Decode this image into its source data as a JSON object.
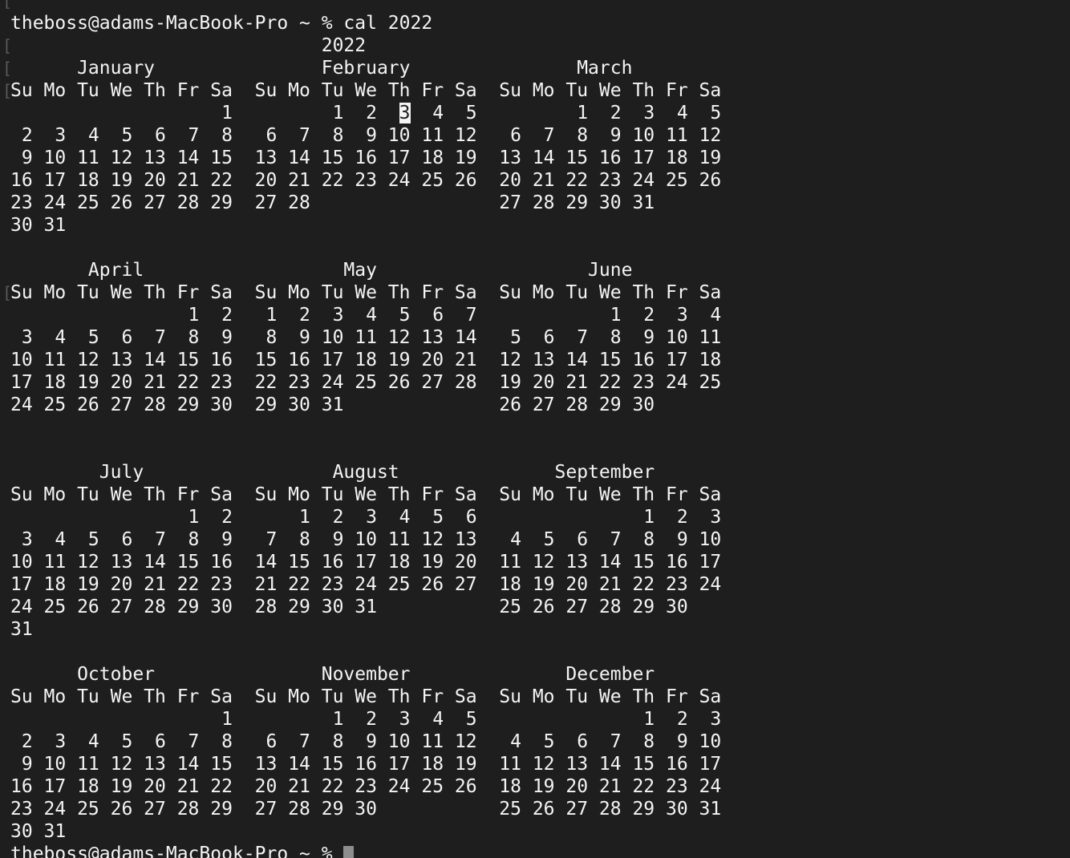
{
  "terminal": {
    "prompt": "theboss@adams-MacBook-Pro ~ % ",
    "command": "cal 2022",
    "output_lines": [
      "                            2022",
      "      January               February               March",
      "Su Mo Tu We Th Fr Sa  Su Mo Tu We Th Fr Sa  Su Mo Tu We Th Fr Sa",
      "                   1         1  2  3  4  5         1  2  3  4  5",
      " 2  3  4  5  6  7  8   6  7  8  9 10 11 12   6  7  8  9 10 11 12",
      " 9 10 11 12 13 14 15  13 14 15 16 17 18 19  13 14 15 16 17 18 19",
      "16 17 18 19 20 21 22  20 21 22 23 24 25 26  20 21 22 23 24 25 26",
      "23 24 25 26 27 28 29  27 28                 27 28 29 30 31",
      "30 31",
      "",
      "       April                  May                   June",
      "Su Mo Tu We Th Fr Sa  Su Mo Tu We Th Fr Sa  Su Mo Tu We Th Fr Sa",
      "                1  2   1  2  3  4  5  6  7            1  2  3  4",
      " 3  4  5  6  7  8  9   8  9 10 11 12 13 14   5  6  7  8  9 10 11",
      "10 11 12 13 14 15 16  15 16 17 18 19 20 21  12 13 14 15 16 17 18",
      "17 18 19 20 21 22 23  22 23 24 25 26 27 28  19 20 21 22 23 24 25",
      "24 25 26 27 28 29 30  29 30 31              26 27 28 29 30",
      "",
      "",
      "        July                 August              September",
      "Su Mo Tu We Th Fr Sa  Su Mo Tu We Th Fr Sa  Su Mo Tu We Th Fr Sa",
      "                1  2      1  2  3  4  5  6               1  2  3",
      " 3  4  5  6  7  8  9   7  8  9 10 11 12 13   4  5  6  7  8  9 10",
      "10 11 12 13 14 15 16  14 15 16 17 18 19 20  11 12 13 14 15 16 17",
      "17 18 19 20 21 22 23  21 22 23 24 25 26 27  18 19 20 21 22 23 24",
      "24 25 26 27 28 29 30  28 29 30 31           25 26 27 28 29 30",
      "31",
      "",
      "      October               November              December",
      "Su Mo Tu We Th Fr Sa  Su Mo Tu We Th Fr Sa  Su Mo Tu We Th Fr Sa",
      "                   1         1  2  3  4  5               1  2  3",
      " 2  3  4  5  6  7  8   6  7  8  9 10 11 12   4  5  6  7  8  9 10",
      " 9 10 11 12 13 14 15  13 14 15 16 17 18 19  11 12 13 14 15 16 17",
      "16 17 18 19 20 21 22  20 21 22 23 24 25 26  18 19 20 21 22 23 24",
      "23 24 25 26 27 28 29  27 28 29 30           25 26 27 28 29 30 31",
      "30 31"
    ],
    "highlight": {
      "line": 3,
      "text": " 3"
    },
    "final_prompt": "theboss@adams-MacBook-Pro ~ % ",
    "mark_glyph": "[",
    "mark_lines": [
      -1,
      0,
      1,
      2,
      11
    ]
  },
  "colors": {
    "background": "#1e1e1e",
    "foreground": "#f4f4f4",
    "cursor": "#8e8e8e"
  }
}
